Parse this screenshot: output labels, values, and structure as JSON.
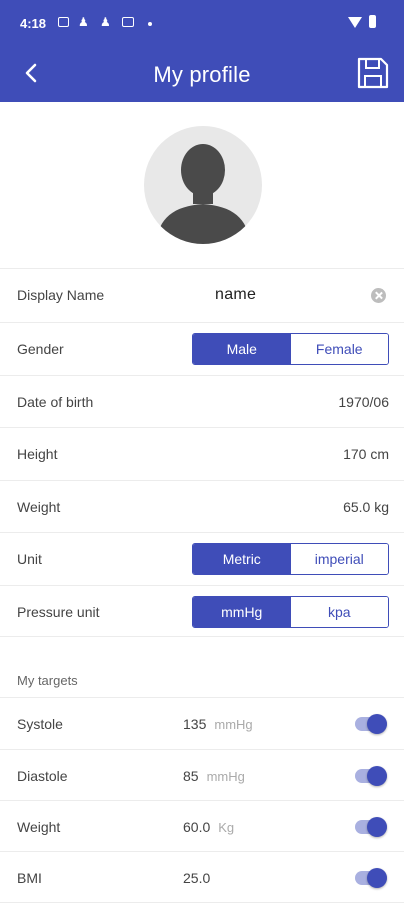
{
  "status_bar": {
    "time": "4:18"
  },
  "app_bar": {
    "title": "My profile",
    "back_icon": "arrow-back-icon",
    "save_icon": "save-floppy-icon"
  },
  "colors": {
    "primary": "#3f4db8",
    "toggle_track": "#a9b0e0"
  },
  "profile": {
    "display_name": {
      "label": "Display Name",
      "value": "name"
    },
    "gender": {
      "label": "Gender",
      "options": [
        "Male",
        "Female"
      ],
      "selected": "Male"
    },
    "dob": {
      "label": "Date of birth",
      "value": "1970/06"
    },
    "height": {
      "label": "Height",
      "value": "170 cm"
    },
    "weight": {
      "label": "Weight",
      "value": "65.0 kg"
    },
    "unit": {
      "label": "Unit",
      "options": [
        "Metric",
        "imperial"
      ],
      "selected": "Metric"
    },
    "pressure_unit": {
      "label": "Pressure unit",
      "options": [
        "mmHg",
        "kpa"
      ],
      "selected": "mmHg"
    }
  },
  "targets": {
    "heading": "My targets",
    "items": [
      {
        "label": "Systole",
        "value": "135",
        "unit": "mmHg",
        "enabled": true
      },
      {
        "label": "Diastole",
        "value": "85",
        "unit": "mmHg",
        "enabled": true
      },
      {
        "label": "Weight",
        "value": "60.0",
        "unit": "Kg",
        "enabled": true
      },
      {
        "label": "BMI",
        "value": "25.0",
        "unit": "",
        "enabled": true
      }
    ]
  }
}
